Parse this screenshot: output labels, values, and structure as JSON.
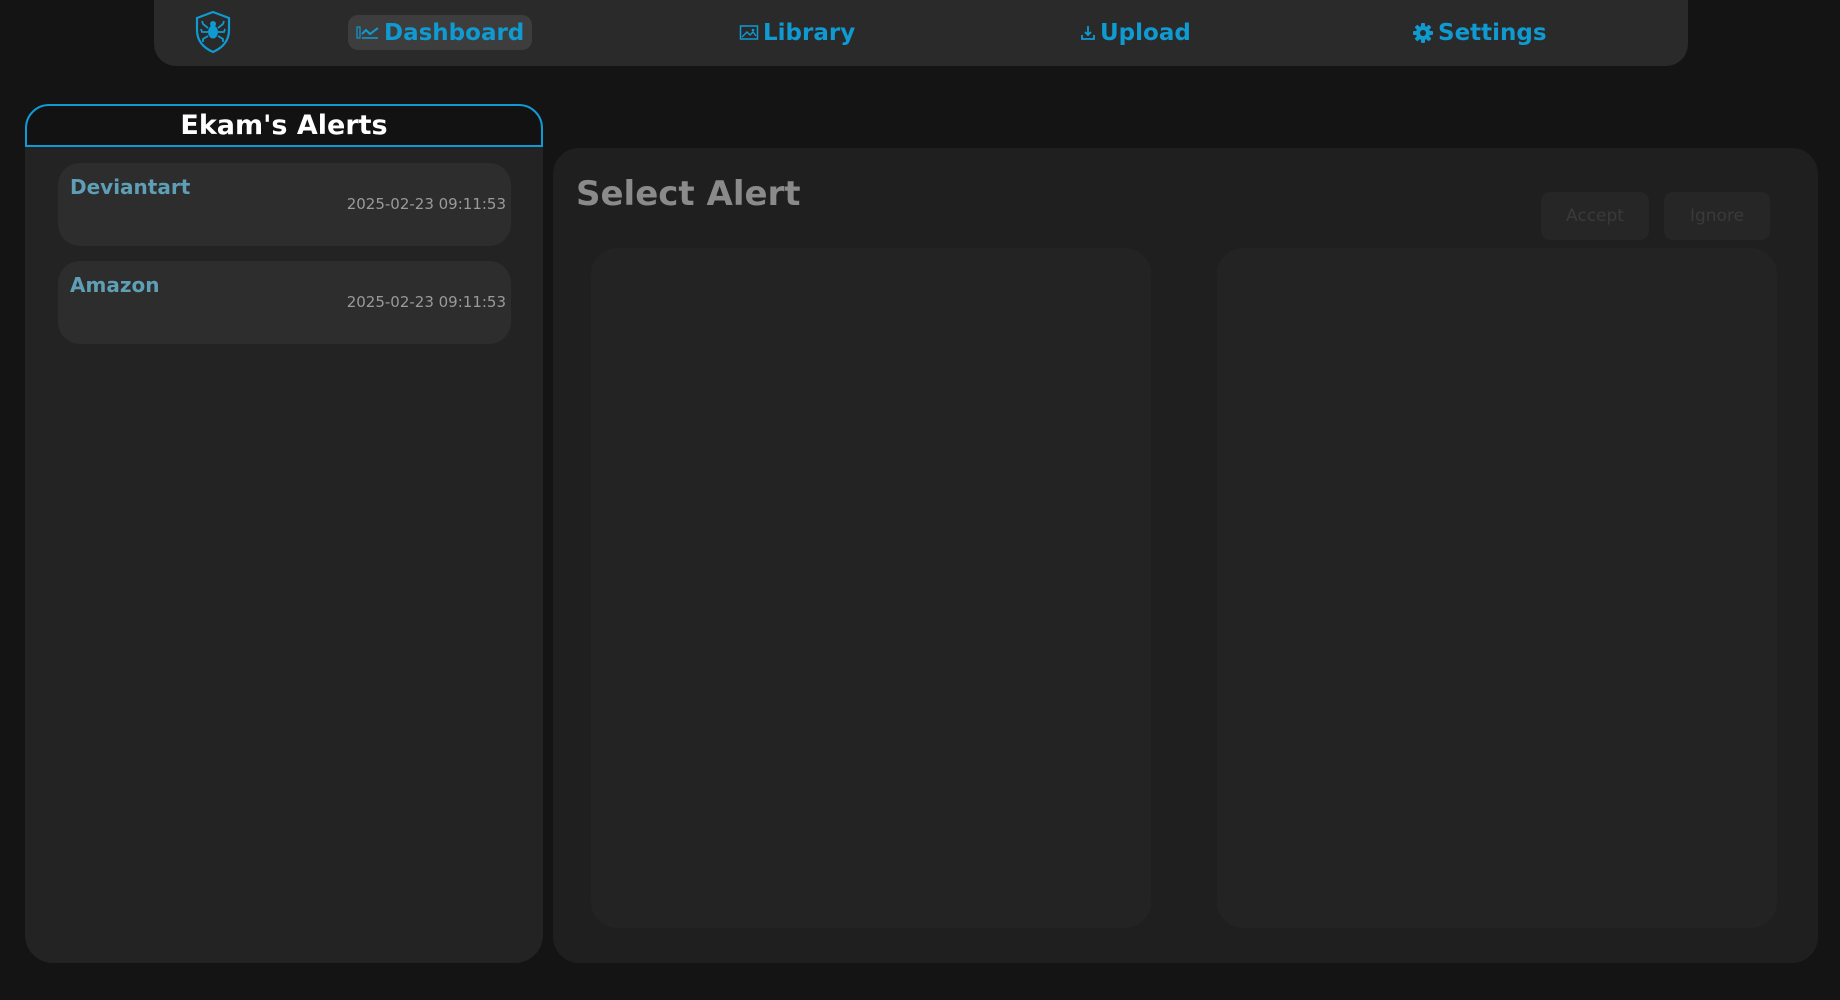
{
  "nav": {
    "logo_icon": "shield-spider-icon",
    "items": [
      {
        "label": "Dashboard",
        "icon": "chart-icon",
        "active": true
      },
      {
        "label": "Library",
        "icon": "image-icon",
        "active": false
      },
      {
        "label": "Upload",
        "icon": "upload-icon",
        "active": false
      },
      {
        "label": "Settings",
        "icon": "gear-icon",
        "active": false
      }
    ]
  },
  "sidebar": {
    "title": "Ekam's Alerts",
    "alerts": [
      {
        "name": "Deviantart",
        "timestamp": "2025-02-23 09:11:53"
      },
      {
        "name": "Amazon",
        "timestamp": "2025-02-23 09:11:53"
      }
    ]
  },
  "main": {
    "title": "Select Alert",
    "accept_label": "Accept",
    "ignore_label": "Ignore"
  },
  "colors": {
    "accent": "#0f9ad2",
    "background": "#141414",
    "panel": "#232323",
    "alert_name": "#5f9fb5"
  }
}
